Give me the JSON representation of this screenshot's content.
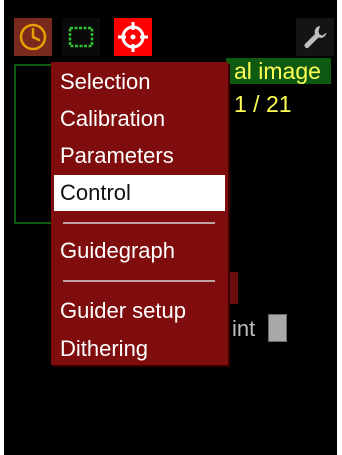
{
  "toolbar": {
    "buttons": [
      {
        "icon": "clock-icon",
        "color": "#e8a000"
      },
      {
        "icon": "frame-icon",
        "color": "#2fbf2f"
      },
      {
        "icon": "crosshair-icon",
        "color": "#ffffff"
      },
      {
        "icon": "wrench-icon",
        "color": "#bfbfbf"
      }
    ]
  },
  "background": {
    "image_label": "al image",
    "counter": "1 / 21",
    "int_label": "int"
  },
  "menu": {
    "items": [
      {
        "label": "Selection"
      },
      {
        "label": "Calibration"
      },
      {
        "label": "Parameters"
      },
      {
        "label": "Control",
        "selected": true
      },
      {
        "label": "Guidegraph"
      },
      {
        "label": "Guider setup"
      },
      {
        "label": "Dithering"
      }
    ]
  },
  "colors": {
    "menu_bg": "#7f0d0d",
    "selected_bg": "#ffffff",
    "accent_green": "#0e5a12",
    "accent_yellow": "#ffff55",
    "target_red": "#ff0000"
  }
}
